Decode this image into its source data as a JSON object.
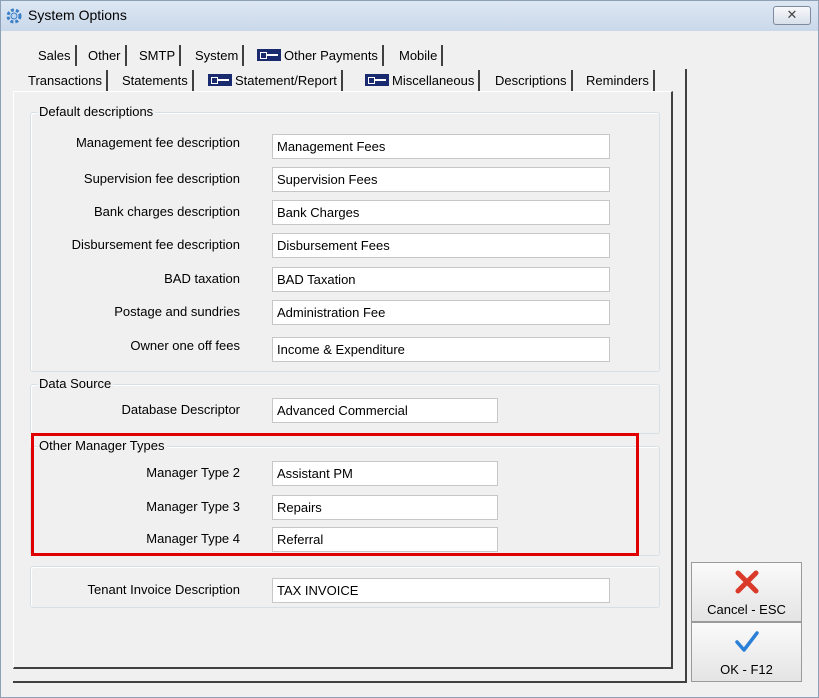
{
  "window": {
    "title": "System Options",
    "close_label": "✕"
  },
  "tabs_row1": [
    {
      "label": "Sales",
      "key_icon": false
    },
    {
      "label": "Other",
      "key_icon": false
    },
    {
      "label": "SMTP",
      "key_icon": false
    },
    {
      "label": "System",
      "key_icon": false
    },
    {
      "label": "Other Payments",
      "key_icon": true
    },
    {
      "label": "Mobile",
      "key_icon": false
    }
  ],
  "tabs_row2": [
    {
      "label": "Transactions",
      "key_icon": false
    },
    {
      "label": "Statements",
      "key_icon": false
    },
    {
      "label": "Statement/Report",
      "key_icon": true
    },
    {
      "label": "Miscellaneous",
      "key_icon": true
    },
    {
      "label": "Descriptions",
      "key_icon": false,
      "active": true
    },
    {
      "label": "Reminders",
      "key_icon": false
    }
  ],
  "default_descriptions": {
    "title": "Default descriptions",
    "fields": [
      {
        "label": "Management fee description",
        "value": "Management Fees"
      },
      {
        "label": "Supervision fee description",
        "value": "Supervision Fees"
      },
      {
        "label": "Bank charges description",
        "value": "Bank Charges"
      },
      {
        "label": "Disbursement fee description",
        "value": "Disbursement Fees"
      },
      {
        "label": "BAD taxation",
        "value": "BAD Taxation"
      },
      {
        "label": "Postage and sundries",
        "value": "Administration Fee"
      },
      {
        "label": "Owner one off fees",
        "value": "Income & Expenditure"
      }
    ]
  },
  "data_source": {
    "title": "Data Source",
    "fields": [
      {
        "label": "Database Descriptor",
        "value": "Advanced Commercial"
      }
    ]
  },
  "other_manager_types": {
    "title": "Other Manager Types",
    "fields": [
      {
        "label": "Manager Type 2",
        "value": "Assistant PM"
      },
      {
        "label": "Manager Type 3",
        "value": "Repairs"
      },
      {
        "label": "Manager Type 4",
        "value": "Referral"
      }
    ]
  },
  "tenant_invoice": {
    "label": "Tenant Invoice Description",
    "value": "TAX INVOICE"
  },
  "buttons": {
    "cancel_label": "Cancel - ESC",
    "ok_label": "OK - F12"
  },
  "colors": {
    "highlight": "#e00000",
    "cancel_icon": "#d93a2a",
    "ok_icon": "#2a7fd6",
    "key_icon": "#1a2a6e"
  }
}
